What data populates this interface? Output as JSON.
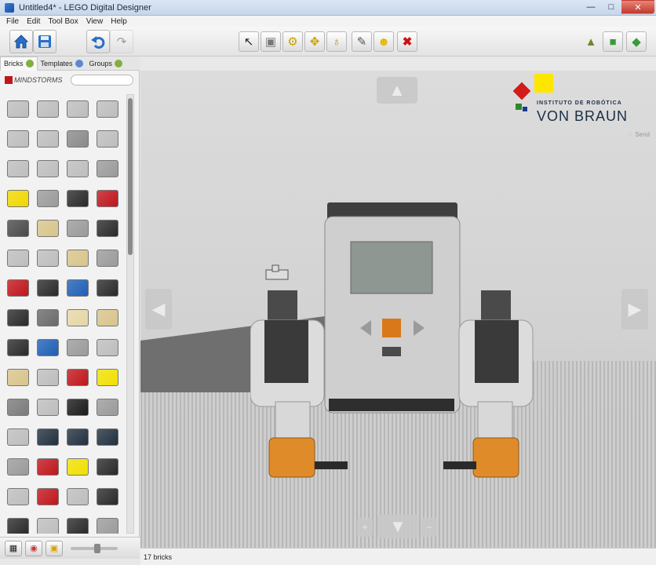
{
  "window": {
    "title": "Untitled4* - LEGO Digital Designer",
    "min": "—",
    "max": "□",
    "close": "✕"
  },
  "menu": [
    "File",
    "Edit",
    "Tool Box",
    "View",
    "Help"
  ],
  "toolbar": {
    "home_icon": "home-icon",
    "save_icon": "save-icon",
    "undo_icon": "undo-icon",
    "redo_icon": "redo-icon",
    "tools": [
      "select-tool-icon",
      "clone-tool-icon",
      "hinge-tool-icon",
      "hinge-align-tool-icon",
      "flex-tool-icon",
      "paint-tool-icon",
      "decorate-tool-icon",
      "delete-tool-icon"
    ],
    "modes": [
      "build-mode-icon",
      "view-mode-icon",
      "building-guide-icon"
    ]
  },
  "tabs": [
    {
      "label": "Bricks",
      "active": true
    },
    {
      "label": "Templates",
      "active": false
    },
    {
      "label": "Groups",
      "active": false
    }
  ],
  "brand": {
    "name": "MINDSTORMS",
    "search_placeholder": ""
  },
  "bricks": [
    [
      "#bdbdbd",
      "#bdbdbd",
      "#bdbdbd",
      "#bdbdbd"
    ],
    [
      "#bdbdbd",
      "#bdbdbd",
      "#8a8a8a",
      "#bdbdbd"
    ],
    [
      "#bdbdbd",
      "#bdbdbd",
      "#bdbdbd",
      "#9a9a9a"
    ],
    [
      "#f0d800",
      "#9a9a9a",
      "#2a2a2a",
      "#c0161b"
    ],
    [
      "#4a4a4a",
      "#d8c48a",
      "#9a9a9a",
      "#2a2a2a"
    ],
    [
      "#bdbdbd",
      "#bdbdbd",
      "#d8c48a",
      "#9a9a9a"
    ],
    [
      "#c0161b",
      "#2a2a2a",
      "#1f5fb5",
      "#2a2a2a"
    ],
    [
      "#2a2a2a",
      "#6a6a6a",
      "#e6d6a6",
      "#d8c48a"
    ],
    [
      "#2a2a2a",
      "#1f5fb5",
      "#9a9a9a",
      "#bdbdbd"
    ],
    [
      "#d8c48a",
      "#bdbdbd",
      "#c0161b",
      "#f0e000"
    ],
    [
      "#7a7a7a",
      "#bdbdbd",
      "#1a1a1a",
      "#9a9a9a"
    ],
    [
      "#bdbdbd",
      "#22303f",
      "#22303f",
      "#22303f"
    ],
    [
      "#9a9a9a",
      "#c0161b",
      "#f0e000",
      "#2a2a2a"
    ],
    [
      "#bdbdbd",
      "#c0161b",
      "#bdbdbd",
      "#2a2a2a"
    ],
    [
      "#2a2a2a",
      "#bdbdbd",
      "#2a2a2a",
      "#9a9a9a"
    ]
  ],
  "scene": {
    "send_label": "Send",
    "logo_small": "INSTITUTO DE ROBÓTICA",
    "logo_big": "VON BRAUN"
  },
  "status": {
    "brick_count": "17 bricks"
  },
  "colors": {
    "accent_orange": "#d9781a",
    "brand_red": "#d21b1b",
    "brand_yellow": "#ffe600"
  }
}
